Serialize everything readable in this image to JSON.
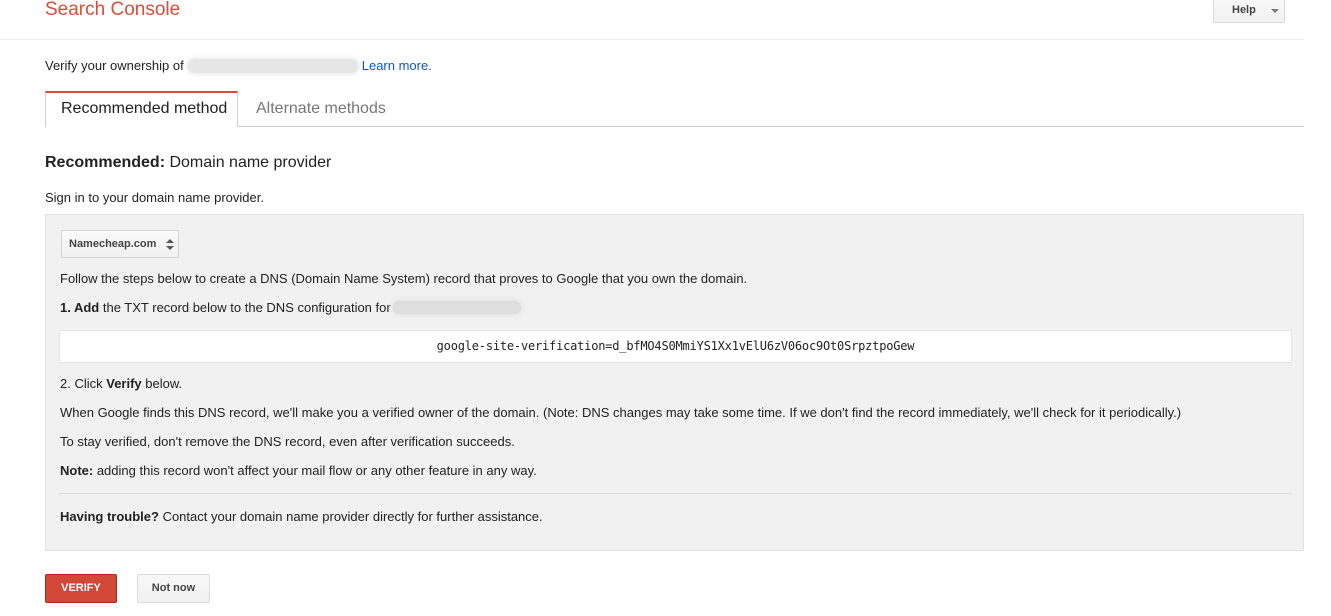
{
  "header": {
    "app_title": "Search Console",
    "help_label": "Help"
  },
  "verify": {
    "prefix": "Verify your ownership of",
    "learn_more": "Learn more."
  },
  "tabs": [
    {
      "label": "Recommended method",
      "active": true
    },
    {
      "label": "Alternate methods",
      "active": false
    }
  ],
  "recommended": {
    "heading_bold": "Recommended:",
    "heading_rest": " Domain name provider",
    "signin": "Sign in to your domain name provider."
  },
  "panel": {
    "provider_selected": "Namecheap.com",
    "intro": "Follow the steps below to create a DNS (Domain Name System) record that proves to Google that you own the domain.",
    "step1_bold": "1. Add",
    "step1_rest": " the TXT record below to the DNS configuration for",
    "txt_record": "google-site-verification=d_bfMO4S0MmiYS1Xx1vElU6zV06oc9Ot0SrpztpoGew",
    "step2_prefix": "2. Click ",
    "step2_bold": "Verify",
    "step2_suffix": " below.",
    "when_found": "When Google finds this DNS record, we'll make you a verified owner of the domain. (Note: DNS changes may take some time. If we don't find the record immediately, we'll check for it periodically.)",
    "stay_verified": "To stay verified, don't remove the DNS record, even after verification succeeds.",
    "note_bold": "Note:",
    "note_rest": " adding this record won't affect your mail flow or any other feature in any way.",
    "trouble_bold": "Having trouble?",
    "trouble_rest": " Contact your domain name provider directly for further assistance."
  },
  "actions": {
    "verify_label": "VERIFY",
    "not_now_label": "Not now"
  },
  "colors": {
    "brand_red": "#dd4b39",
    "verify_button": "#d14836",
    "link_blue": "#1155cc",
    "panel_bg": "#f1f1f1"
  },
  "icons": {
    "help_dropdown": "caret-down-icon",
    "provider_select": "sort-updown-icon"
  }
}
